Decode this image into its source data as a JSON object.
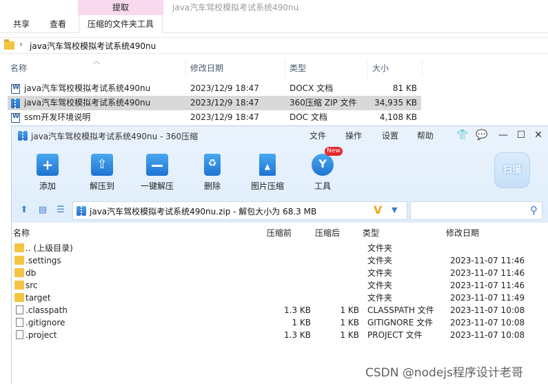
{
  "explorer": {
    "context_tab": "提取",
    "window_title": "java汽车驾校模拟考试系统490nu",
    "tabs": [
      "共享",
      "查看",
      "压缩的文件夹工具"
    ],
    "address": "java汽车驾校模拟考试系统490nu",
    "columns": [
      "名称",
      "修改日期",
      "类型",
      "大小"
    ],
    "files": [
      {
        "name": "java汽车驾校模拟考试系统490nu",
        "date": "2023/12/9 18:47",
        "type": "DOCX 文档",
        "size": "81 KB",
        "icon": "word-doc-icon"
      },
      {
        "name": "java汽车驾校模拟考试系统490nu",
        "date": "2023/12/9 18:47",
        "type": "360压缩 ZIP 文件",
        "size": "34,935 KB",
        "icon": "zip-archive-icon"
      },
      {
        "name": "ssm开发环境说明",
        "date": "2023/12/9 18:47",
        "type": "DOC 文档",
        "size": "4,108 KB",
        "icon": "word-doc-icon"
      }
    ]
  },
  "zip": {
    "title": "java汽车驾校模拟考试系统490nu - 360压缩",
    "menu": [
      "文件",
      "操作",
      "设置",
      "帮助"
    ],
    "toolbar": [
      "添加",
      "解压到",
      "一键解压",
      "删除",
      "图片压缩",
      "工具"
    ],
    "new_badge": "New",
    "scan_label": "扫描",
    "address": "java汽车驾校模拟考试系统490nu.zip - 解包大小为 68.3 MB",
    "columns": [
      "名称",
      "压缩前",
      "压缩后",
      "类型",
      "修改日期"
    ],
    "rows": [
      {
        "name": ".. (上级目录)",
        "before": "",
        "after": "",
        "type": "文件夹",
        "date": "",
        "icon": "folder-icon"
      },
      {
        "name": ".settings",
        "before": "",
        "after": "",
        "type": "文件夹",
        "date": "2023-11-07 11:46",
        "icon": "folder-icon"
      },
      {
        "name": "db",
        "before": "",
        "after": "",
        "type": "文件夹",
        "date": "2023-11-07 11:46",
        "icon": "folder-icon"
      },
      {
        "name": "src",
        "before": "",
        "after": "",
        "type": "文件夹",
        "date": "2023-11-07 11:46",
        "icon": "folder-icon"
      },
      {
        "name": "target",
        "before": "",
        "after": "",
        "type": "文件夹",
        "date": "2023-11-07 11:49",
        "icon": "folder-icon"
      },
      {
        "name": ".classpath",
        "before": "1.3 KB",
        "after": "1 KB",
        "type": "CLASSPATH 文件",
        "date": "2023-11-07 10:08",
        "icon": "file-icon"
      },
      {
        "name": ".gitignore",
        "before": "1 KB",
        "after": "1 KB",
        "type": "GITIGNORE 文件",
        "date": "2023-11-07 10:08",
        "icon": "file-icon"
      },
      {
        "name": ".project",
        "before": "1.3 KB",
        "after": "1 KB",
        "type": "PROJECT 文件",
        "date": "2023-11-07 10:08",
        "icon": "file-icon"
      }
    ]
  },
  "watermark": "CSDN @nodejs程序设计老哥",
  "colors": {
    "context_tab_bg": "#f8d9ee",
    "zip_header_bg": "#e3effb",
    "accent_blue": "#1e73d2",
    "selected_row": "#d9d9d9",
    "badge_red": "#e5262c"
  }
}
